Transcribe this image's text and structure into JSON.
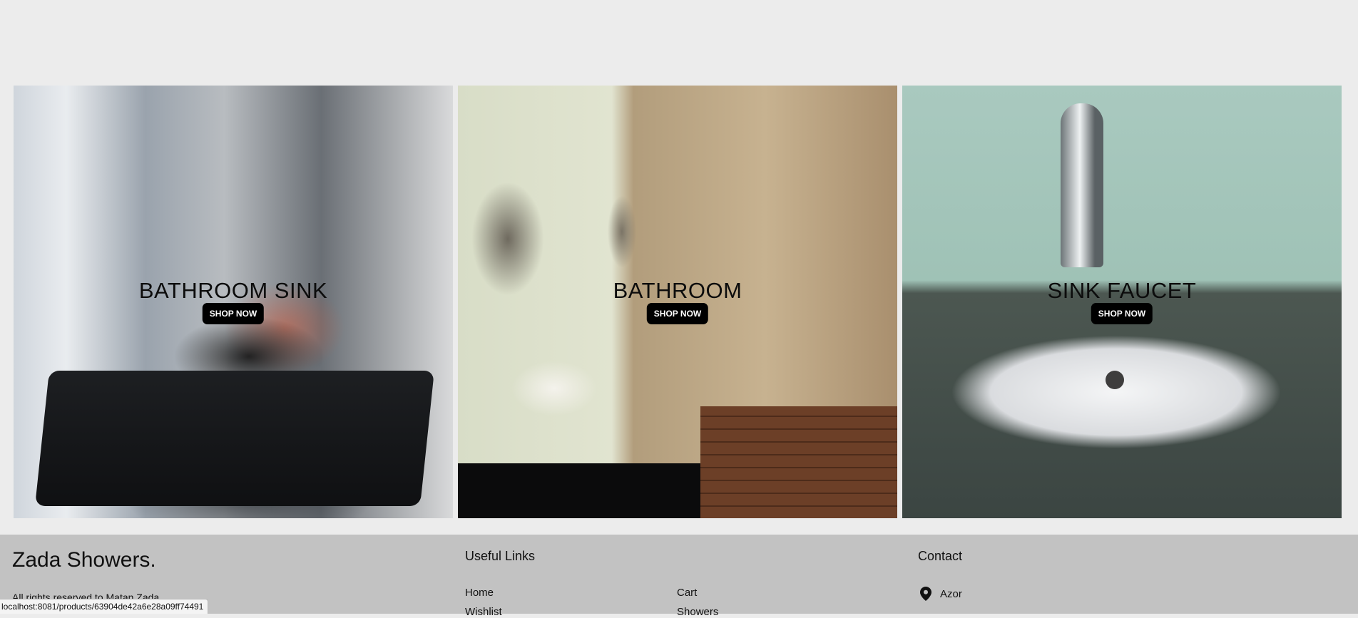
{
  "categories": [
    {
      "title": "BATHROOM SINK",
      "button": "SHOP NOW"
    },
    {
      "title": "BATHROOM",
      "button": "SHOP NOW"
    },
    {
      "title": "SINK FAUCET",
      "button": "SHOP NOW"
    }
  ],
  "footer": {
    "brand": "Zada Showers.",
    "rights": "All rights reserved to Matan Zada",
    "useful_links_title": "Useful Links",
    "links": [
      "Home",
      "Cart",
      "Wishlist",
      "Showers"
    ],
    "contact_title": "Contact",
    "contact_location": "Azor",
    "contact_icon": "map-pin-icon"
  },
  "status_bar": {
    "url": "localhost:8081/products/63904de42a6e28a09ff74491"
  },
  "colors": {
    "page_background": "#ececec",
    "footer_background": "#c2c2c2",
    "button_background": "#000000",
    "button_text": "#ffffff"
  }
}
